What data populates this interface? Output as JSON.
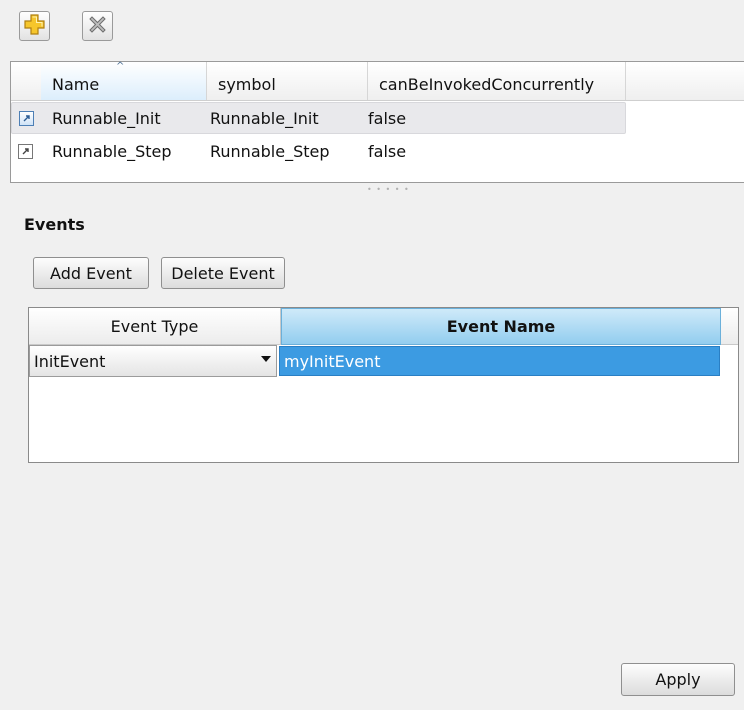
{
  "toolbar": {
    "add_icon": "plus-icon",
    "delete_icon": "delete-x-icon"
  },
  "runnables": {
    "columns": [
      "Name",
      "symbol",
      "canBeInvokedConcurrently"
    ],
    "sorted_column": "Name",
    "rows": [
      {
        "name": "Runnable_Init",
        "symbol": "Runnable_Init",
        "concurrent": "false",
        "selected": true
      },
      {
        "name": "Runnable_Step",
        "symbol": "Runnable_Step",
        "concurrent": "false",
        "selected": false
      }
    ]
  },
  "events": {
    "title": "Events",
    "add_label": "Add Event",
    "delete_label": "Delete Event",
    "columns": [
      "Event Type",
      "Event Name"
    ],
    "rows": [
      {
        "type": "InitEvent",
        "name": "myInitEvent"
      }
    ]
  },
  "apply_label": "Apply",
  "colors": {
    "selection": "#3c9be2",
    "header_selected": "#92cdef",
    "background": "#f0f0f0"
  }
}
